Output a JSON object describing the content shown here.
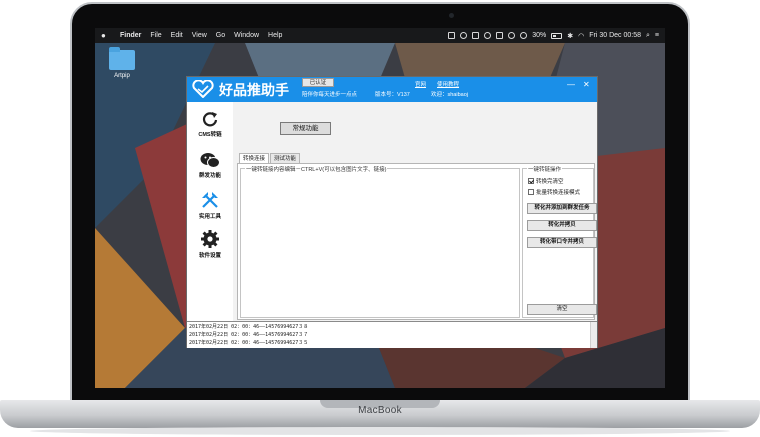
{
  "laptop": {
    "brand": "MacBook"
  },
  "menubar": {
    "app": "Finder",
    "items": [
      "File",
      "Edit",
      "View",
      "Go",
      "Window",
      "Help"
    ],
    "battery": "30%",
    "clock": "Fri 30 Dec  00:58"
  },
  "desktop": {
    "folder_label": "Artpip"
  },
  "app": {
    "title": "好品推助手",
    "cert_label": "已认证",
    "slogan": "陪伴你每天进步一点点",
    "website_link": "官网",
    "tutorial_link": "使用教程",
    "version": "版本号：V137",
    "welcome": "欢迎：shaibaoj",
    "minimize": "—",
    "close": "✕",
    "sidebar": [
      {
        "label": "CMS转链",
        "icon": "refresh-icon"
      },
      {
        "label": "群发功能",
        "icon": "wechat-icon"
      },
      {
        "label": "实用工具",
        "icon": "tools-icon"
      },
      {
        "label": "软件设置",
        "icon": "gear-icon"
      }
    ],
    "main_button": "常规功能",
    "tabs": [
      "转换连接",
      "测试功能"
    ],
    "editor_group_title": "一键转链接内容编辑－CTRL+V(可以包含图片文字、链接)",
    "ops_group_title": "一键转链操作",
    "checkboxes": [
      {
        "label": "转换完清空",
        "checked": true
      },
      {
        "label": "批量转换连接模式",
        "checked": false
      }
    ],
    "buttons": {
      "convert_add_task": "转化并添加到群发任务",
      "convert_copy": "转化并拷贝",
      "convert_qr_copy": "转化带口令并拷贝",
      "clear": "清空"
    },
    "log_lines": [
      "2017年02月22日 02：00：46——14576994627３８",
      "2017年02月22日 02：00：46——14576994627３７",
      "2017年02月22日 02：00：46——14576994627３５"
    ]
  },
  "colors": {
    "accent": "#1a8fe8"
  }
}
